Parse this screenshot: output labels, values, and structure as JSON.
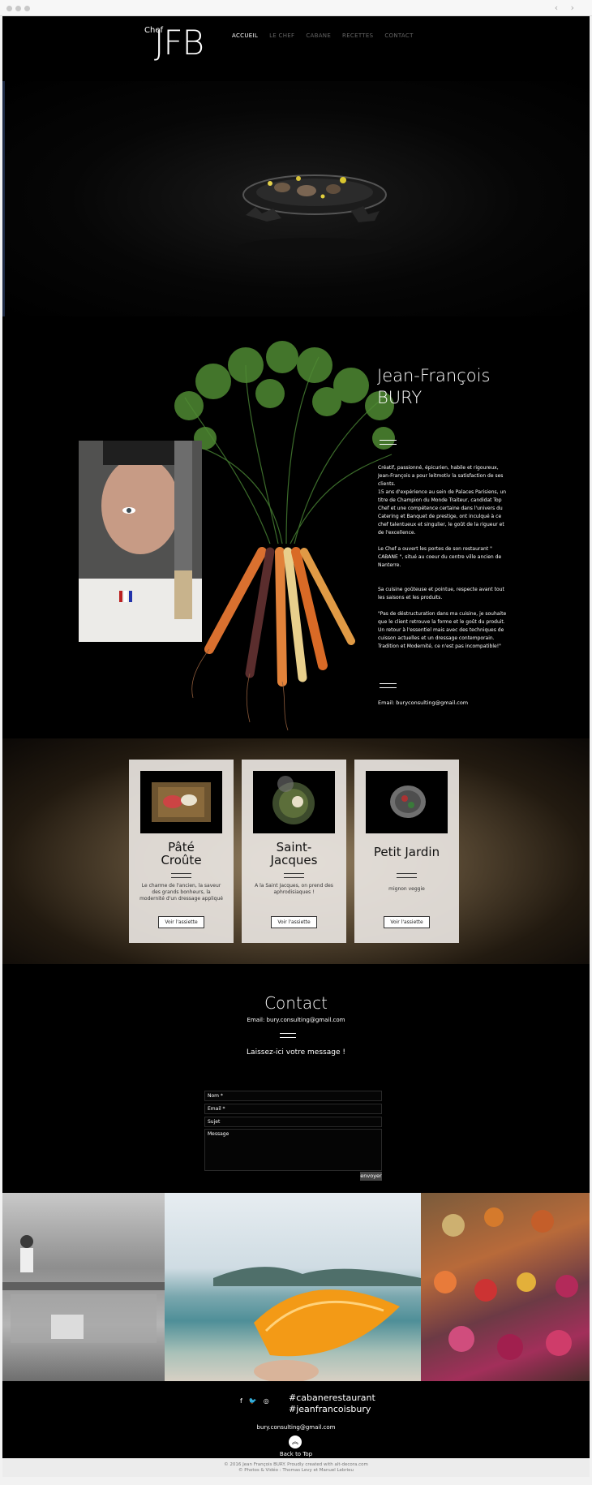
{
  "header": {
    "logo_small": "Chef",
    "logo_big": "JFB",
    "menu": [
      {
        "label": "ACCUEIL",
        "active": true
      },
      {
        "label": "LE CHEF",
        "active": false
      },
      {
        "label": "CABANE",
        "active": false
      },
      {
        "label": "RECETTES",
        "active": false
      },
      {
        "label": "CONTACT",
        "active": false
      }
    ]
  },
  "about": {
    "name_line1": "Jean-François",
    "name_line2": "BURY",
    "paragraphs": [
      "Créatif, passionné, épicurien, habile et rigoureux, Jean-François a pour leitmotiv la satisfaction de ses clients.",
      "15 ans d'expérience au sein de Palaces Parisiens, un titre de Champion du Monde Traiteur, candidat Top Chef et une compétence certaine dans l'univers du Catering et Banquet de prestige, ont inculqué à ce chef talentueux et singulier, le goût de la rigueur et de l'excellence.",
      "Le Chef a ouvert les portes de son restaurant \" CABANE \", situé au coeur du centre ville ancien de Nanterre.",
      "Sa cuisine goûteuse et pointue, respecte avant tout les saisons et les produits.",
      "\"Pas de déstructuration dans ma cuisine, je souhaite que le client retrouve la forme et le goût du produit. Un retour à l'essentiel mais avec des techniques de cuisson actuelles et un dressage contemporain. Tradition et Modernité, ce n'est pas incompatible!\""
    ],
    "email": "Email: buryconsulting@gmail.com"
  },
  "dishes": [
    {
      "title_l1": "Pâté",
      "title_l2": "Croûte",
      "desc": "Le charme de l'ancien, la saveur des grands bonheurs, la modernité d'un dressage appliqué",
      "button": "Voir l'assiette"
    },
    {
      "title_l1": "Saint-",
      "title_l2": "Jacques",
      "desc": "A la Saint Jacques, on prend des aphrodisiaques !",
      "button": "Voir l'assiette"
    },
    {
      "title_l1": "Petit Jardin",
      "title_l2": "",
      "desc": "mignon veggie",
      "button": "Voir l'assiette"
    }
  ],
  "contact": {
    "title": "Contact",
    "email": "Email: bury.consulting@gmail.com",
    "message": "Laissez-ici votre message !",
    "fields": {
      "name": "Nom *",
      "email": "Email *",
      "subject": "Sujet",
      "message": "Message"
    },
    "send": "envoyer"
  },
  "footer": {
    "social_icons": [
      "facebook-icon",
      "twitter-icon",
      "instagram-icon"
    ],
    "hashtag1": "#cabanerestaurant",
    "hashtag2": "#jeanfrancoisbury",
    "email": "bury.consulting@gmail.com",
    "back_to_top": "Back to Top",
    "copyright1": "© 2016 Jean François BURY. Proudly created with alt-decora.com",
    "copyright2": "© Photos & Vidéo : Thomas Levy et Manuel Lebrieu"
  }
}
